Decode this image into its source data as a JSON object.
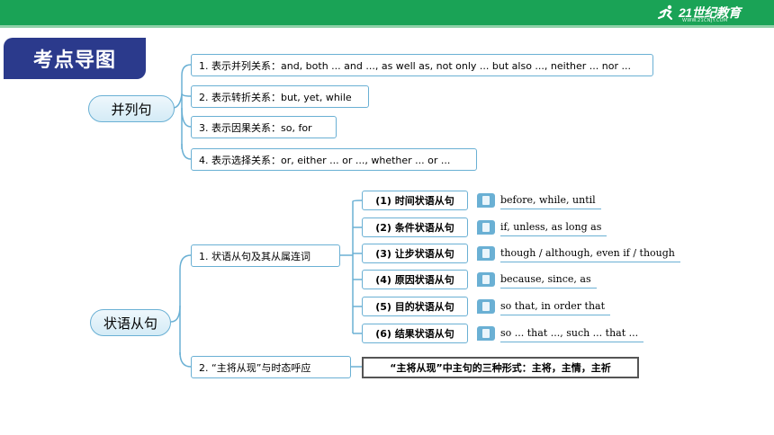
{
  "header": {
    "logo_text": "21世纪教育",
    "logo_sub": "WWW.21CNJY.COM"
  },
  "title": "考点导图",
  "coordinate": {
    "label": "并列句",
    "items": [
      "1. 表示并列关系：and, both ... and ..., as well as, not only ... but also ..., neither ... nor ...",
      "2. 表示转折关系：but, yet, while",
      "3. 表示因果关系：so, for",
      "4. 表示选择关系：or, either ... or ..., whether ... or ..."
    ]
  },
  "adverbial": {
    "label": "状语从句",
    "branch1": "1. 状语从句及其从属连词",
    "clauses": [
      {
        "name": "(1) 时间状语从句",
        "conj": "before, while, until"
      },
      {
        "name": "(2) 条件状语从句",
        "conj": "if, unless, as long as"
      },
      {
        "name": "(3) 让步状语从句",
        "conj": "though / although, even if / though"
      },
      {
        "name": "(4) 原因状语从句",
        "conj": "because, since, as"
      },
      {
        "name": "(5) 目的状语从句",
        "conj": "so that, in order that"
      },
      {
        "name": "(6) 结果状语从句",
        "conj": "so ... that ..., such ... that ..."
      }
    ],
    "branch2": "2. “主将从现”与时态呼应",
    "branch2_detail": "“主将从现”中主句的三种形式：主将，主情，主祈"
  }
}
